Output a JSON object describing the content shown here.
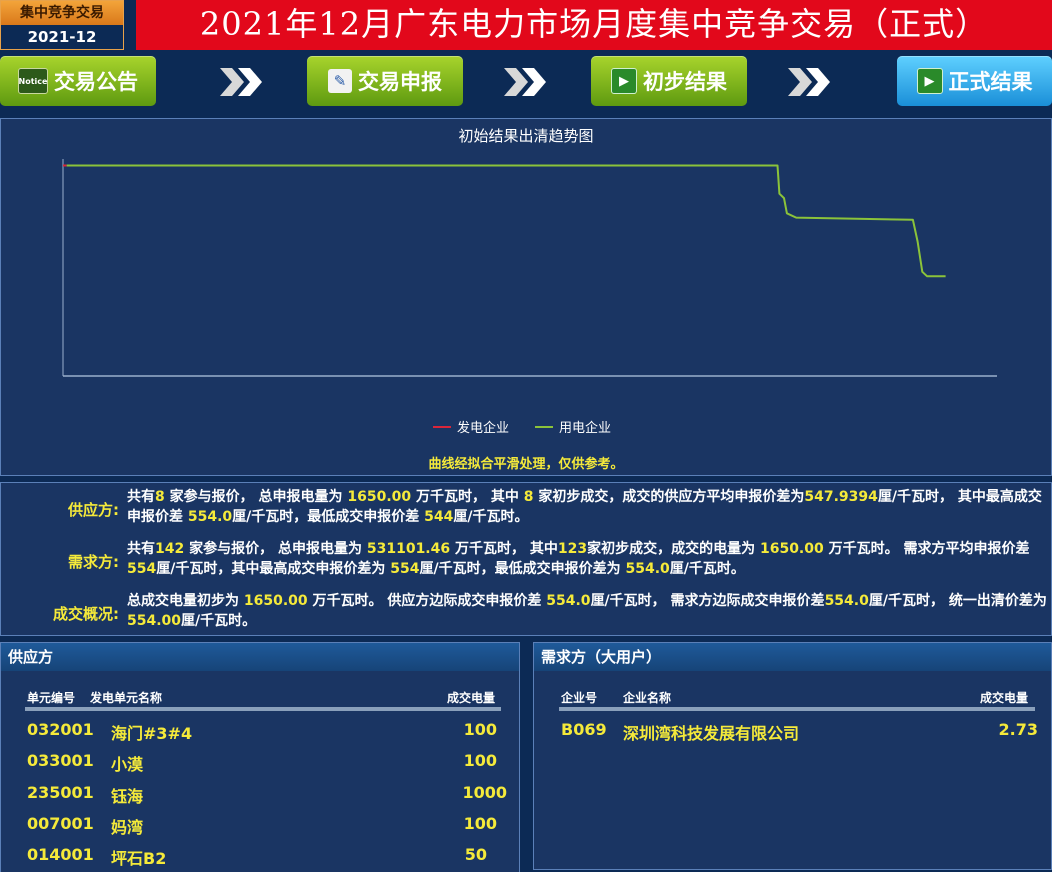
{
  "header": {
    "badge_top": "集中竞争交易",
    "badge_bottom": "2021-12",
    "title": "2021年12月广东电力市场月度集中竞争交易（正式）"
  },
  "nav": {
    "steps": [
      {
        "label": "交易公告",
        "icon": "notice-icon",
        "icon_text": "Notice"
      },
      {
        "label": "交易申报",
        "icon": "edit-icon"
      },
      {
        "label": "初步结果",
        "icon": "play-icon"
      },
      {
        "label": "正式结果",
        "icon": "play-icon"
      }
    ],
    "chevron": "»"
  },
  "chart_data": {
    "type": "line",
    "title": "初始结果出清趋势图",
    "series": [
      {
        "name": "发电企业",
        "color": "#d9263a",
        "points": [
          [
            0,
            0.97
          ],
          [
            0.4,
            0.97
          ]
        ]
      },
      {
        "name": "用电企业",
        "color": "#8bc33a",
        "points": [
          [
            0.4,
            0.97
          ],
          [
            76.5,
            0.97
          ],
          [
            76.7,
            0.84
          ],
          [
            77.2,
            0.82
          ],
          [
            77.5,
            0.75
          ],
          [
            78.5,
            0.73
          ],
          [
            91.0,
            0.72
          ],
          [
            91.5,
            0.62
          ],
          [
            92.0,
            0.48
          ],
          [
            92.5,
            0.46
          ],
          [
            94.5,
            0.46
          ]
        ]
      }
    ],
    "xlim": [
      0,
      100
    ],
    "ylim": [
      0,
      1
    ],
    "grid": false,
    "legend_position": "bottom-center",
    "note": "曲线经拟合平滑处理，仅供参考。"
  },
  "summary": {
    "supply": {
      "label": "供应方:",
      "t1": "共有",
      "v1": "8",
      "t2": " 家参与报价， 总申报电量为 ",
      "v2": "1650.00",
      "t3": " 万千瓦时， 其中 ",
      "v3": "8",
      "t4": " 家初步成交，成交的供应方平均申报价差为",
      "v4": "547.9394",
      "t5": "厘/千瓦时， 其中最高成交申报价差 ",
      "v5": "554.0",
      "t6": "厘/千瓦时，最低成交申报价差 ",
      "v6": "544",
      "t7": "厘/千瓦时。"
    },
    "demand": {
      "label": "需求方:",
      "t1": "共有",
      "v1": "142",
      "t2": " 家参与报价， 总申报电量为 ",
      "v2": "531101.46",
      "t3": " 万千瓦时， 其中",
      "v3": "123",
      "t4": "家初步成交，成交的电量为 ",
      "v4": "1650.00",
      "t5": " 万千瓦时。 需求方平均申报价差 ",
      "v5": "554",
      "t6": "厘/千瓦时，其中最高成交申报价差为 ",
      "v6": "554",
      "t7": "厘/千瓦时，最低成交申报价差为 ",
      "v7": "554.0",
      "t8": "厘/千瓦时。"
    },
    "overview": {
      "label": "成交概况:",
      "t1": "总成交电量初步为 ",
      "v1": "1650.00",
      "t2": " 万千瓦时。 供应方边际成交申报价差 ",
      "v2": "554.0",
      "t3": "厘/千瓦时， 需求方边际成交申报价差",
      "v3": "554.0",
      "t4": "厘/千瓦时， 统一出清价差为",
      "v4": "554.00",
      "t5": "厘/千瓦时。"
    }
  },
  "supply_table": {
    "title": "供应方",
    "headers": [
      "单元编号",
      "发电单元名称",
      "成交电量"
    ],
    "rows": [
      {
        "id": "032001",
        "name": "海门#3#4",
        "amount": "100"
      },
      {
        "id": "033001",
        "name": "小漠",
        "amount": "100"
      },
      {
        "id": "235001",
        "name": "钰海",
        "amount": "1000"
      },
      {
        "id": "007001",
        "name": "妈湾",
        "amount": "100"
      },
      {
        "id": "014001",
        "name": "坪石B2",
        "amount": "50"
      }
    ]
  },
  "demand_table": {
    "title": "需求方（大用户）",
    "headers": [
      "企业号",
      "企业名称",
      "成交电量"
    ],
    "rows": [
      {
        "id": "B069",
        "name": "深圳湾科技发展有限公司",
        "amount": "2.73"
      }
    ]
  }
}
